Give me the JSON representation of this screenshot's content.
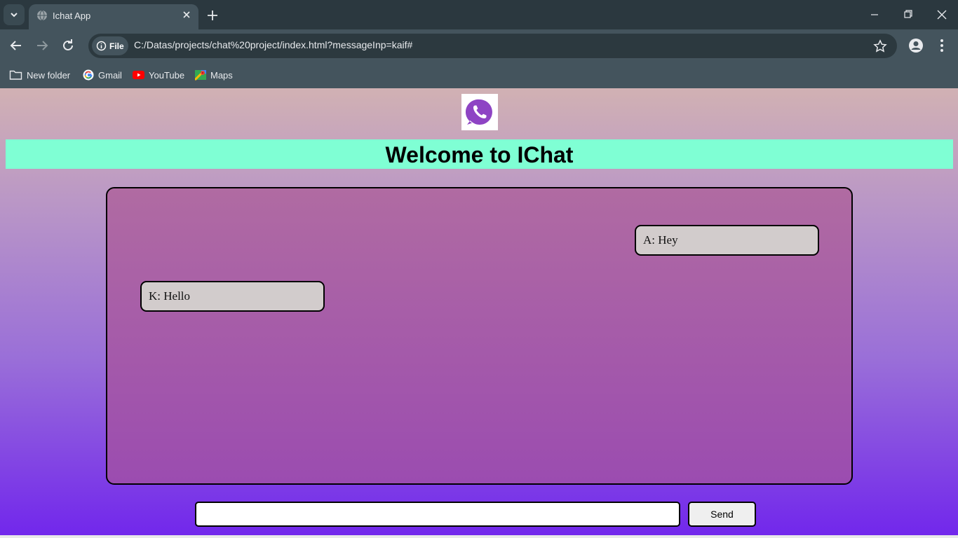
{
  "browser": {
    "tab_title": "Ichat App",
    "url": "C:/Datas/projects/chat%20project/index.html?messageInp=kaif#",
    "site_info_label": "File",
    "bookmarks": [
      {
        "label": "New folder",
        "icon": "folder-icon"
      },
      {
        "label": "Gmail",
        "icon": "google-icon"
      },
      {
        "label": "YouTube",
        "icon": "youtube-icon"
      },
      {
        "label": "Maps",
        "icon": "maps-icon"
      }
    ]
  },
  "page": {
    "logo_icon": "phone-chat-icon",
    "heading": "Welcome to IChat",
    "messages": [
      {
        "text": "A: Hey",
        "side": "right"
      },
      {
        "text": "K: Hello",
        "side": "left"
      }
    ],
    "input_value": "",
    "send_label": "Send"
  },
  "colors": {
    "banner": "#7fffd4",
    "bubble": "#d2cccc",
    "logo_purple": "#8e44c4"
  }
}
